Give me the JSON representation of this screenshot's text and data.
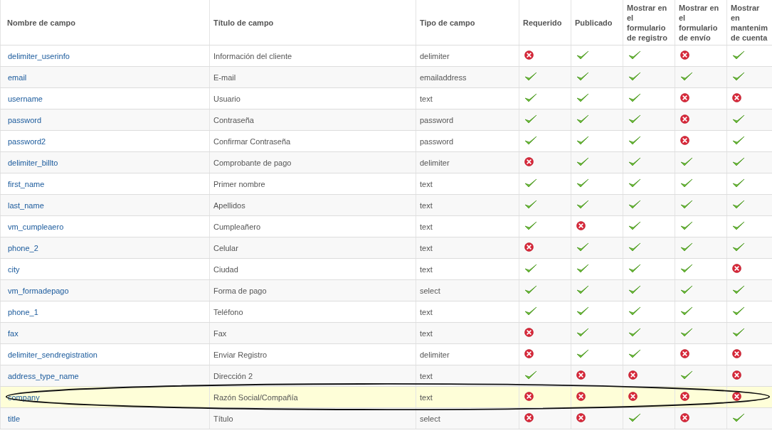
{
  "table": {
    "columns": [
      "Nombre de campo",
      "Título de campo",
      "Tipo de campo",
      "Requerido",
      "Publicado",
      "Mostrar en el formulario de registro",
      "Mostrar en el formulario de envío",
      "Mostrar en mantenim de cuenta"
    ],
    "rows": [
      {
        "name": "delimiter_userinfo",
        "title": "Información del cliente",
        "type": "delimiter",
        "flags": [
          false,
          true,
          true,
          false,
          true
        ],
        "selected": false
      },
      {
        "name": "email",
        "title": "E-mail",
        "type": "emailaddress",
        "flags": [
          true,
          true,
          true,
          true,
          true
        ],
        "selected": false
      },
      {
        "name": "username",
        "title": "Usuario",
        "type": "text",
        "flags": [
          true,
          true,
          true,
          false,
          false
        ],
        "selected": false
      },
      {
        "name": "password",
        "title": "Contraseña",
        "type": "password",
        "flags": [
          true,
          true,
          true,
          false,
          true
        ],
        "selected": false
      },
      {
        "name": "password2",
        "title": "Confirmar Contraseña",
        "type": "password",
        "flags": [
          true,
          true,
          true,
          false,
          true
        ],
        "selected": false
      },
      {
        "name": "delimiter_billto",
        "title": "Comprobante de pago",
        "type": "delimiter",
        "flags": [
          false,
          true,
          true,
          true,
          true
        ],
        "selected": false
      },
      {
        "name": "first_name",
        "title": "Primer nombre",
        "type": "text",
        "flags": [
          true,
          true,
          true,
          true,
          true
        ],
        "selected": false
      },
      {
        "name": "last_name",
        "title": "Apellidos",
        "type": "text",
        "flags": [
          true,
          true,
          true,
          true,
          true
        ],
        "selected": false
      },
      {
        "name": "vm_cumpleaero",
        "title": "Cumpleañero",
        "type": "text",
        "flags": [
          true,
          false,
          true,
          true,
          true
        ],
        "selected": false
      },
      {
        "name": "phone_2",
        "title": "Celular",
        "type": "text",
        "flags": [
          false,
          true,
          true,
          true,
          true
        ],
        "selected": false
      },
      {
        "name": "city",
        "title": "Ciudad",
        "type": "text",
        "flags": [
          true,
          true,
          true,
          true,
          false
        ],
        "selected": false
      },
      {
        "name": "vm_formadepago",
        "title": "Forma de pago",
        "type": "select",
        "flags": [
          true,
          true,
          true,
          true,
          true
        ],
        "selected": false
      },
      {
        "name": "phone_1",
        "title": "Teléfono",
        "type": "text",
        "flags": [
          true,
          true,
          true,
          true,
          true
        ],
        "selected": false
      },
      {
        "name": "fax",
        "title": "Fax",
        "type": "text",
        "flags": [
          false,
          true,
          true,
          true,
          true
        ],
        "selected": false
      },
      {
        "name": "delimiter_sendregistration",
        "title": "Enviar Registro",
        "type": "delimiter",
        "flags": [
          false,
          true,
          true,
          false,
          false
        ],
        "selected": false
      },
      {
        "name": "address_type_name",
        "title": "Dirección 2",
        "type": "text",
        "flags": [
          true,
          false,
          false,
          true,
          false
        ],
        "selected": false
      },
      {
        "name": "company",
        "title": "Razón Social/Compañía",
        "type": "text",
        "flags": [
          false,
          false,
          false,
          false,
          false
        ],
        "selected": true
      },
      {
        "name": "title",
        "title": "Título",
        "type": "select",
        "flags": [
          false,
          false,
          true,
          false,
          true
        ],
        "selected": false
      }
    ]
  }
}
